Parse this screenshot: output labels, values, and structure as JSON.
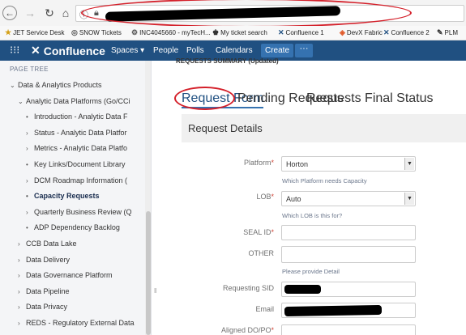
{
  "bookmarks": [
    {
      "icon": "★",
      "icon_color": "#d4a017",
      "label": "JET Service Desk"
    },
    {
      "icon": "◎",
      "icon_color": "#555555",
      "label": "SNOW Tickets"
    },
    {
      "icon": "⚙",
      "icon_color": "#555555",
      "label": "INC4045660 - myTecH..."
    },
    {
      "icon": "♚",
      "icon_color": "#333333",
      "label": "My ticket search"
    },
    {
      "icon": "✕",
      "icon_color": "#205081",
      "label": "Confluence 1"
    },
    {
      "icon": "◈",
      "icon_color": "#e05a2a",
      "label": "DevX Fabric"
    },
    {
      "icon": "✕",
      "icon_color": "#205081",
      "label": "Confluence 2"
    },
    {
      "icon": "✎",
      "icon_color": "#333333",
      "label": "PLM"
    }
  ],
  "header": {
    "brand": "Confluence",
    "nav": [
      "Spaces ▾",
      "People",
      "Polls",
      "Calendars"
    ],
    "create": "Create",
    "more": "···",
    "bg_color": "#205081"
  },
  "sidebar": {
    "heading": "PAGE TREE",
    "items": [
      {
        "chev": "⌄",
        "label": "Data & Analytics Products",
        "bold": false
      },
      {
        "chev": "⌄",
        "label": "Analytic Data Platforms (Go/CCi",
        "bold": false
      },
      {
        "chev": "•",
        "label": "Introduction - Analytic Data F",
        "bold": false
      },
      {
        "chev": "›",
        "label": "Status - Analytic Data Platfor",
        "bold": false
      },
      {
        "chev": "›",
        "label": "Metrics - Analytic Data Platfo",
        "bold": false
      },
      {
        "chev": "•",
        "label": "Key Links/Document Library",
        "bold": false
      },
      {
        "chev": "›",
        "label": "DCM Roadmap Information (",
        "bold": false
      },
      {
        "chev": "•",
        "label": "Capacity Requests",
        "bold": true
      },
      {
        "chev": "›",
        "label": "Quarterly Business Review (Q",
        "bold": false
      },
      {
        "chev": "•",
        "label": "ADP Dependency Backlog",
        "bold": false
      },
      {
        "chev": "›",
        "label": "CCB Data Lake",
        "bold": false
      },
      {
        "chev": "›",
        "label": "Data Delivery",
        "bold": false
      },
      {
        "chev": "›",
        "label": "Data Governance Platform",
        "bold": false
      },
      {
        "chev": "›",
        "label": "Data Pipeline",
        "bold": false
      },
      {
        "chev": "›",
        "label": "Data Privacy",
        "bold": false
      },
      {
        "chev": "›",
        "label": "REDS - Regulatory External Data",
        "bold": false
      }
    ]
  },
  "page": {
    "crumb_title": "REQUESTS SUMMARY (Updated)"
  },
  "tabs": [
    "Request Form",
    "Pending Requests",
    "Requests Final Status"
  ],
  "panel": {
    "title": "Request Details"
  },
  "form": {
    "platform_label": "Platform",
    "platform_value": "Horton",
    "platform_hint": "Which Platform needs Capacity",
    "lob_label": "LOB",
    "lob_value": "Auto",
    "lob_hint": "Which LOB is this for?",
    "sealid_label": "SEAL ID",
    "other_label": "OTHER",
    "other_hint": "Please provide Detail",
    "sid_label": "Requesting SID",
    "email_label": "Email",
    "aligned_label": "Aligned DO/PO",
    "required_mark": "*"
  },
  "colors": {
    "accent": "#3572b0",
    "annotation": "#d4202a",
    "required": "#d04437"
  }
}
